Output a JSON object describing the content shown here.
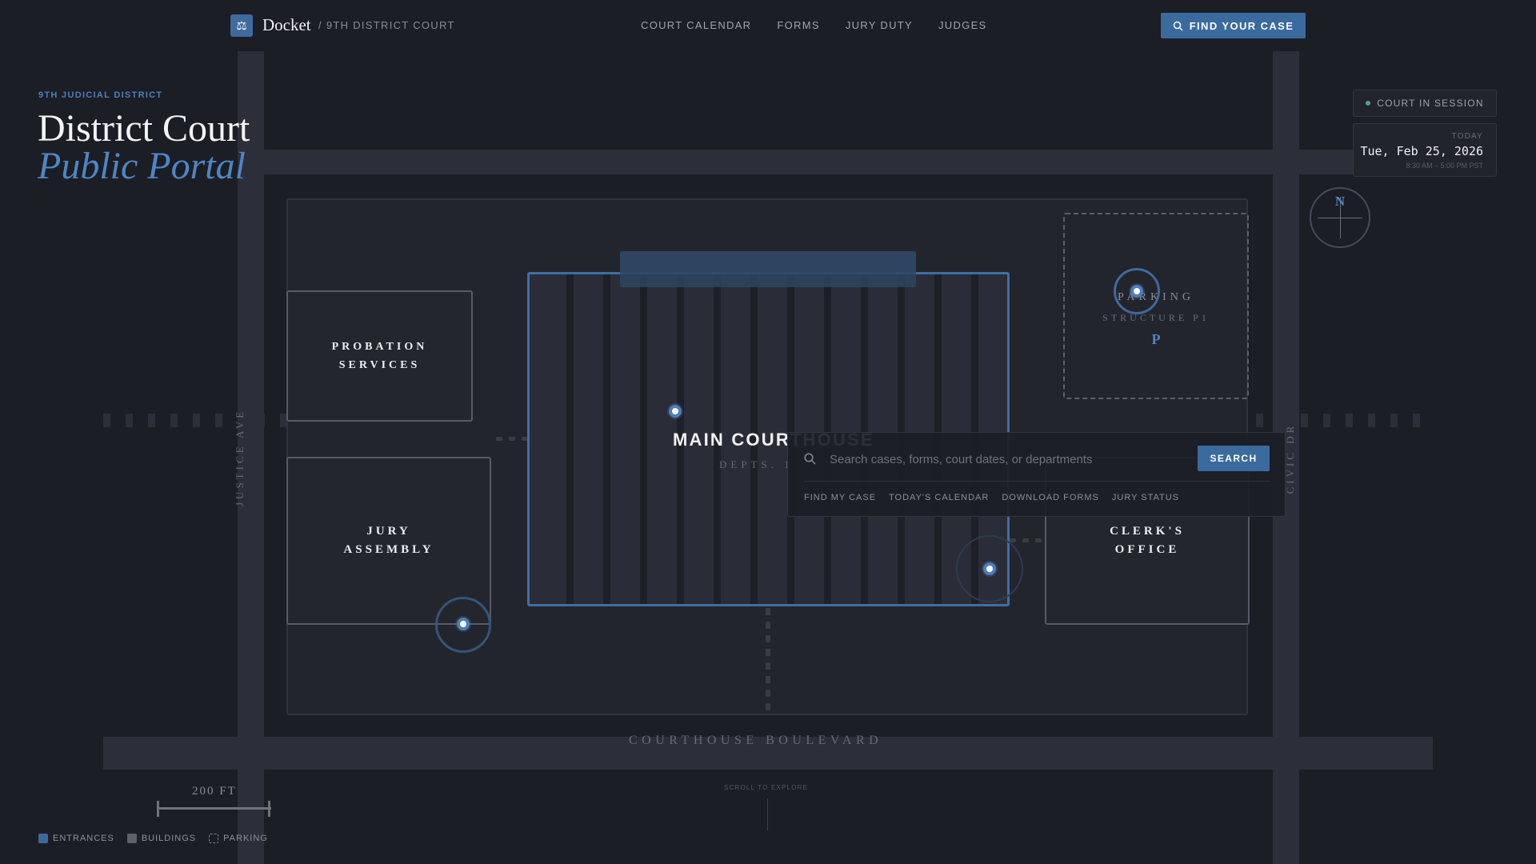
{
  "nav": {
    "logo_icon": "scales-icon",
    "brand": "Docket",
    "crumb": "/ 9TH DISTRICT COURT",
    "links": [
      "COURT CALENDAR",
      "FORMS",
      "JURY DUTY",
      "JUDGES"
    ],
    "find_case": "FIND YOUR CASE"
  },
  "hero": {
    "kicker": "9TH JUDICIAL DISTRICT",
    "title_line1": "District Court",
    "title_line2": "Public Portal"
  },
  "map": {
    "streets": {
      "west": "JUSTICE AVE",
      "east": "CIVIC DR",
      "south": "COURTHOUSE BOULEVARD"
    },
    "buildings": {
      "probation": [
        "PROBATION",
        "SERVICES"
      ],
      "jury": [
        "JURY",
        "ASSEMBLY"
      ],
      "clerk": [
        "CLERK'S",
        "OFFICE"
      ],
      "main_title": "MAIN COURTHOUSE",
      "main_sub": "DEPTS. 1"
    },
    "parking": {
      "line1": "PARKING",
      "line2": "STRUCTURE P1",
      "symbol": "P"
    },
    "compass": "N",
    "scale": "200 FT"
  },
  "search": {
    "placeholder": "Search cases, forms, court dates, or departments",
    "button": "SEARCH",
    "quick_links": [
      "FIND MY CASE",
      "TODAY'S CALENDAR",
      "DOWNLOAD FORMS",
      "JURY STATUS"
    ]
  },
  "status": {
    "session": "COURT IN SESSION",
    "today_label": "TODAY",
    "date": "Tue, Feb 25, 2026",
    "hours": "8:30 AM – 5:00 PM PST"
  },
  "legend": {
    "entrances": "ENTRANCES",
    "buildings": "BUILDINGS",
    "parking": "PARKING"
  },
  "scroll_hint": "SCROLL TO EXPLORE",
  "colors": {
    "background": "#1c1e25",
    "accent": "#3b6a9e",
    "accent_light": "#4f86c4",
    "session_green": "#4aa37c"
  }
}
